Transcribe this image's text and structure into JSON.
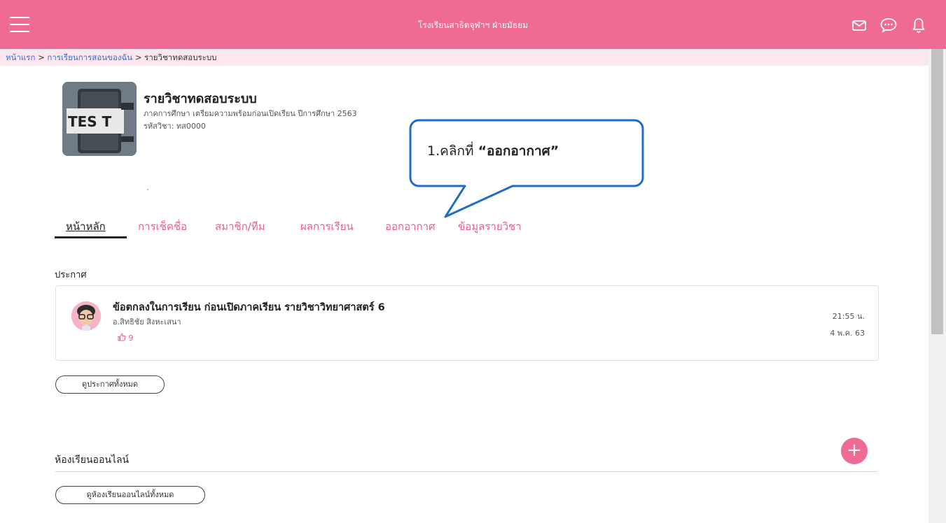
{
  "header": {
    "title": "โรงเรียนสาธิตจุฬาฯ ฝ่ายมัธยม",
    "icons": [
      "menu-icon",
      "mail-icon",
      "chat-icon",
      "bell-icon"
    ]
  },
  "breadcrumb": {
    "home": "หน้าแรก",
    "my_courses": "การเรียนการสอนของฉัน",
    "current": "รายวิชาทดสอบระบบ",
    "separator": ">"
  },
  "course": {
    "image_text": "TES T",
    "title": "รายวิชาทดสอบระบบ",
    "term": "ภาคการศึกษา เตรียมความพร้อมก่อนเปิดเรียน ปีการศึกษา 2563",
    "code": "รหัสวิชา: ทส0000",
    "dot": "`"
  },
  "tabs": [
    {
      "label": "หน้าหลัก",
      "active": true
    },
    {
      "label": "การเช็คชื่อ",
      "active": false
    },
    {
      "label": "สมาชิก/ทีม",
      "active": false
    },
    {
      "label": "ผลการเรียน",
      "active": false
    },
    {
      "label": "ออกอากาศ",
      "active": false
    },
    {
      "label": "ข้อมูลรายวิชา",
      "active": false
    }
  ],
  "announcements": {
    "section_title": "ประกาศ",
    "items": [
      {
        "title": "ข้อตกลงในการเรียน ก่อนเปิดภาคเรียน รายวิชาวิทยาศาสตร์ 6",
        "author": "อ.สิทธิชัย สิงหะเสนา",
        "likes": "9",
        "time": "21:55 น.",
        "date": "4 พ.ค. 63"
      }
    ],
    "view_all": "ดูประกาศทั้งหมด"
  },
  "online_classes": {
    "section_title": "ห้องเรียนออนไลน์",
    "add": "+",
    "view_all": "ดูห้องเรียนออนไลน์ทั้งหมด"
  },
  "callout": {
    "prefix": "1.คลิกที่ ",
    "target": "“ออกอากาศ”"
  },
  "colors": {
    "brand": "#ef6b93",
    "breadcrumb_bg": "#fde7ee",
    "link": "#3b6cc6",
    "callout_border": "#1f6cc4"
  }
}
